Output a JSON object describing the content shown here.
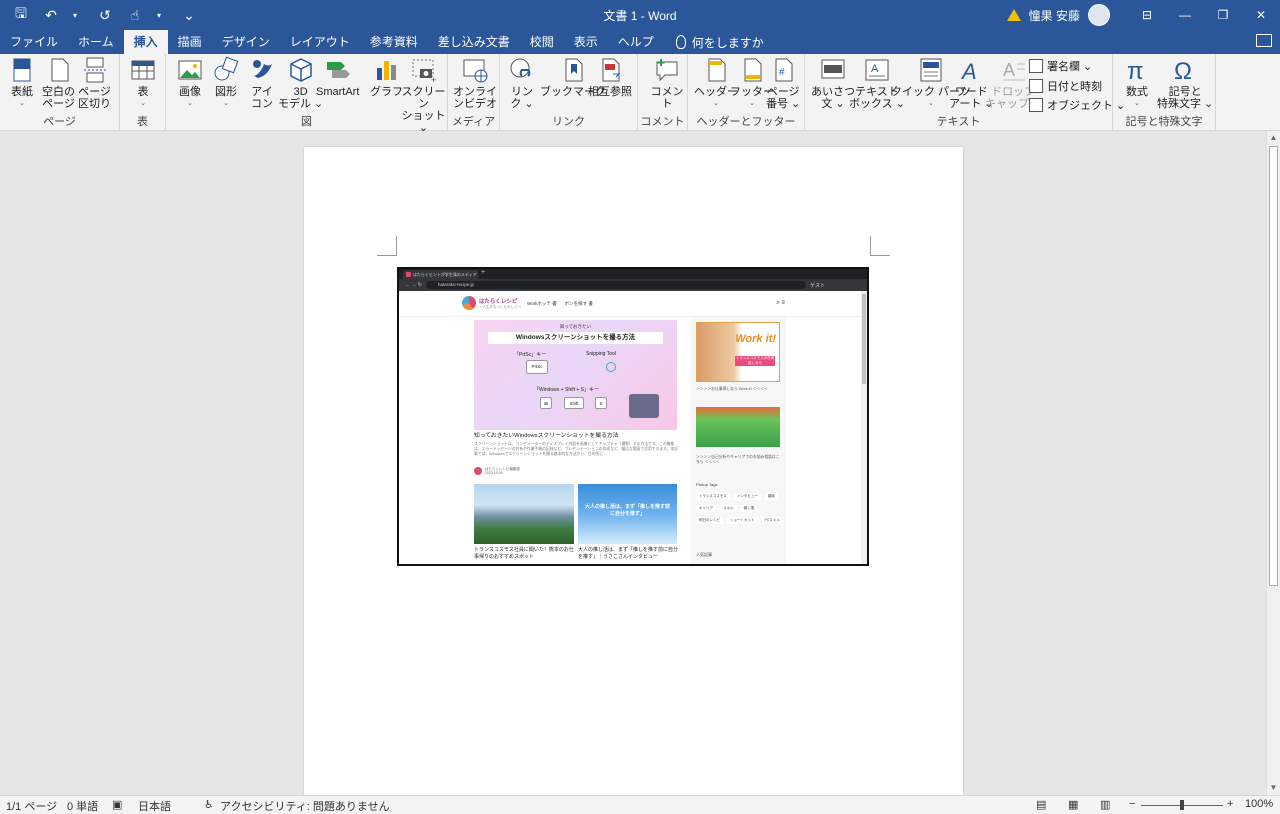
{
  "titlebar": {
    "doc_title": "文書 1  -  Word",
    "user_name": "憧果 安藤",
    "qat": {
      "save": "🖫",
      "undo": "↶",
      "redo": "↺",
      "touch": "☝",
      "customize": "⌄"
    },
    "window": {
      "ribbon_options": "⊟",
      "minimize": "—",
      "restore": "❐",
      "close": "✕"
    }
  },
  "tabs": [
    {
      "label": "ファイル"
    },
    {
      "label": "ホーム"
    },
    {
      "label": "挿入"
    },
    {
      "label": "描画"
    },
    {
      "label": "デザイン"
    },
    {
      "label": "レイアウト"
    },
    {
      "label": "参考資料"
    },
    {
      "label": "差し込み文書"
    },
    {
      "label": "校閲"
    },
    {
      "label": "表示"
    },
    {
      "label": "ヘルプ"
    }
  ],
  "active_tab": "挿入",
  "tell_me": "何をしますか",
  "ribbon": {
    "groups": {
      "pages": "ページ",
      "table": "表",
      "illustrations": "図",
      "media": "メディア",
      "links": "リンク",
      "comments": "コメント",
      "header_footer": "ヘッダーとフッター",
      "text": "テキスト",
      "symbols": "記号と特殊文字"
    },
    "buttons": {
      "cover": [
        "表紙",
        "⌄"
      ],
      "blank": [
        "空白の",
        "ページ"
      ],
      "pagebreak": [
        "ページ",
        "区切り"
      ],
      "table": [
        "表",
        "⌄"
      ],
      "picture": [
        "画像",
        "⌄"
      ],
      "shapes": [
        "図形",
        "⌄"
      ],
      "icons": [
        "アイ",
        "コン"
      ],
      "model3d": [
        "3D",
        "モデル ⌄"
      ],
      "smartart": "SmartArt",
      "chart": "グラフ",
      "screenshot": [
        "スクリーン",
        "ショット ⌄"
      ],
      "online_video": [
        "オンライ",
        "ンビデオ"
      ],
      "link": [
        "リン",
        "ク ⌄"
      ],
      "bookmark": "ブックマーク",
      "crossref": "相互参照",
      "comment": "コメント",
      "header": [
        "ヘッダー",
        "⌄"
      ],
      "footer": [
        "フッター",
        "⌄"
      ],
      "page_number": [
        "ページ",
        "番号 ⌄"
      ],
      "greeting": [
        "あいさつ",
        "文 ⌄"
      ],
      "textbox": [
        "テキスト",
        "ボックス ⌄"
      ],
      "quickparts": [
        "クイック パーツ",
        "⌄"
      ],
      "wordart": [
        "ワード",
        "アート ⌄"
      ],
      "dropcap": [
        "ドロップ",
        "キャップ ⌄"
      ],
      "signature": "署名欄  ⌄",
      "datetime": "日付と時刻",
      "object": "オブジェクト  ⌄",
      "equation": [
        "数式",
        "⌄"
      ],
      "symbol": [
        "記号と",
        "特殊文字 ⌄"
      ]
    }
  },
  "embedded": {
    "tab_title": "はたらくヒントが学生発のメディア",
    "url": "hataraku-recipe.jp",
    "guest": "ゲスト",
    "logo": "はたらくレシピ",
    "logo_sub": "〜人生をもっとたのしく〜",
    "nav": [
      "Workホッテ 書",
      "ボンを探す 書"
    ],
    "hero": {
      "tag": "知っておきたい",
      "title": "Windowsスクリーンショットを撮る方法",
      "left": "「PrtSc」キー",
      "right": "Snipping Tool",
      "key": "PrtSc",
      "combo": "「Windows + Shift + S」キー",
      "keys": [
        "⊞",
        "+",
        "Shift",
        "+",
        "S"
      ]
    },
    "article_title": "知っておきたいWindowsスクリーンショットを撮る方法",
    "article_desc": "スクリーンショットは、コンピューターのディスプレイ内容を画像としてキャプチャ（撮影）する方法です。この機能は、エラーメッセージの共有や作業手順の記録など、プレゼンテーションの作成など、幅広な場面で活用できます。本記事では、Windowsでスクリーンショットを撮る基本的な方法から、目的別に…",
    "author": "はたらくレシピ編集部",
    "author_date": "2023.10.04",
    "card1": "トランスコスモス社員に聞いた！熊本のお仕事帰りのおすすめスポット",
    "card2_overlay": "大人の推し活は、まず「推しを推す前に自分を推す」",
    "card2": "大人の推し活は、まず「推しを推す前に自分を推す」｜うさこさんインタビュー",
    "ad1": "Work it!",
    "ad1_sub": "トランスコスモスの仕事探しなら",
    "side1": "＞＞＞＞お仕事探しなら Work it! ＜＜＜＜",
    "side2": "＞＞＞＞自己分析やキャリアでのお悩み相談はこちら ＜＜＜＜",
    "pickup": "Pickup Tags",
    "tags": [
      "トランスコスモス",
      "インタビュー",
      "趣味",
      "キャリア",
      "スキル",
      "働く場",
      "明日のレシピ",
      "ショートカット",
      "PCスキル"
    ],
    "popular": "人気記事"
  },
  "status": {
    "pages": "1/1 ページ",
    "words": "0 単語",
    "language": "日本語",
    "accessibility": "アクセシビリティ: 問題ありません",
    "zoom": "100%",
    "zoom_out": "−",
    "zoom_in": "+"
  },
  "colors": {
    "accent": "#2b579a",
    "ribbon_bg": "#f3f3f3",
    "canvas": "#e6e6e6"
  }
}
